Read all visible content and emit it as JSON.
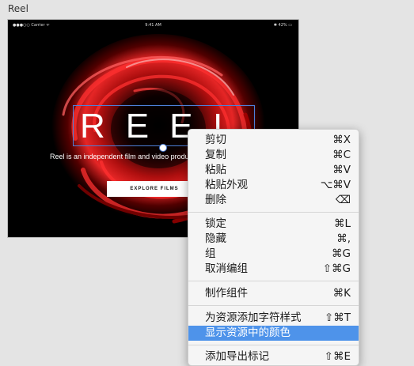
{
  "artboard": {
    "label": "Reel"
  },
  "status_bar": {
    "carrier": "●●●○○ Carrier ᯤ",
    "time": "9:41 AM",
    "battery": "✱ 42% ▭"
  },
  "hero": {
    "title": "REEL",
    "subtitle": "Reel is an independent film and video product",
    "button_label": "EXPLORE FILMS"
  },
  "context_menu": {
    "items": [
      {
        "label": "剪切",
        "shortcut": "⌘X"
      },
      {
        "label": "复制",
        "shortcut": "⌘C"
      },
      {
        "label": "粘贴",
        "shortcut": "⌘V"
      },
      {
        "label": "粘贴外观",
        "shortcut": "⌥⌘V"
      },
      {
        "label": "删除",
        "shortcut": "⌫"
      },
      {
        "label": "锁定",
        "shortcut": "⌘L"
      },
      {
        "label": "隐藏",
        "shortcut": "⌘,"
      },
      {
        "label": "组",
        "shortcut": "⌘G"
      },
      {
        "label": "取消编组",
        "shortcut": "⇧⌘G"
      },
      {
        "label": "制作组件",
        "shortcut": "⌘K"
      },
      {
        "label": "为资源添加字符样式",
        "shortcut": "⇧⌘T"
      },
      {
        "label": "显示资源中的颜色",
        "shortcut": ""
      },
      {
        "label": "添加导出标记",
        "shortcut": "⇧⌘E"
      }
    ]
  },
  "colors": {
    "highlight": "#4e93ea",
    "selection": "#4d7fd8",
    "hero_red": "#d81414"
  }
}
